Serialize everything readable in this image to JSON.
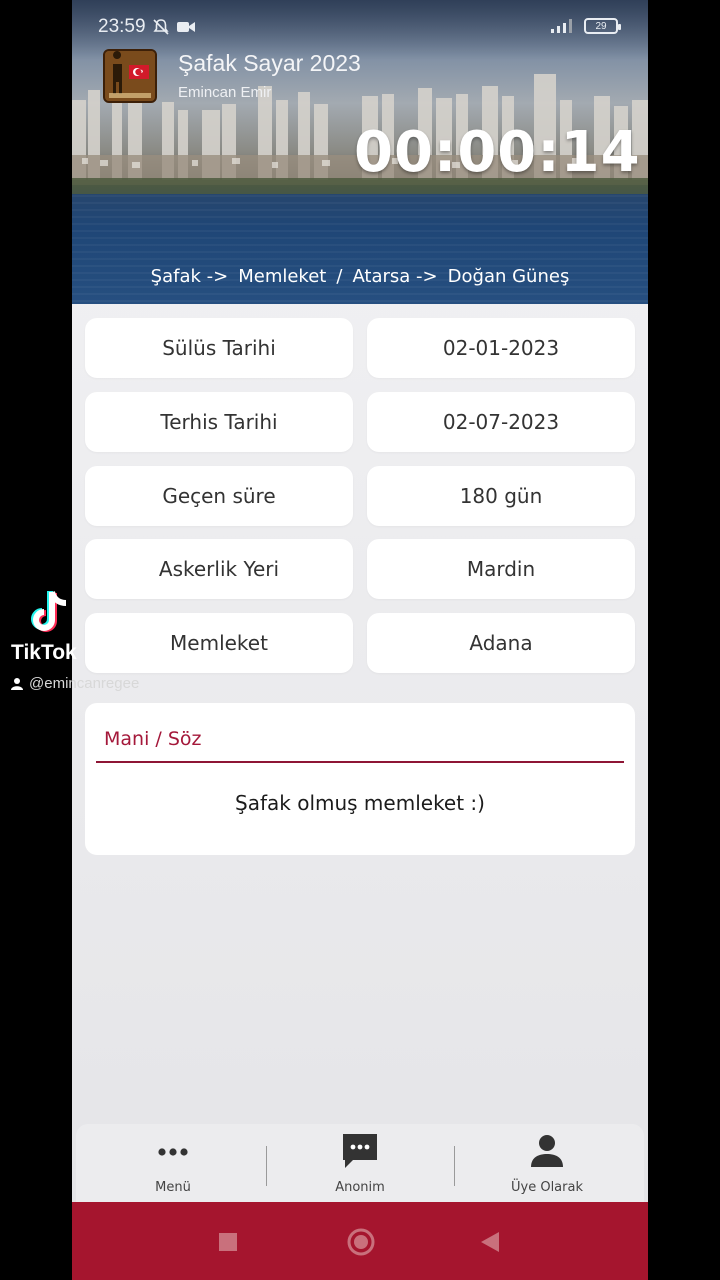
{
  "status_bar": {
    "time": "23:59",
    "battery": "29"
  },
  "app": {
    "title": "Şafak Sayar 2023",
    "subtitle": "Emincan Emir",
    "timer": "00:00:14",
    "route": [
      "Şafak ->",
      "Memleket",
      "/",
      "Atarsa ->",
      "Doğan Güneş"
    ]
  },
  "info": {
    "rows": [
      {
        "label": "Sülüs Tarihi",
        "value": "02-01-2023"
      },
      {
        "label": "Terhis Tarihi",
        "value": "02-07-2023"
      },
      {
        "label": "Geçen süre",
        "value": "180 gün"
      },
      {
        "label": "Askerlik Yeri",
        "value": "Mardin"
      },
      {
        "label": "Memleket",
        "value": "Adana"
      }
    ]
  },
  "mani": {
    "label": "Mani / Söz",
    "text": "Şafak olmuş memleket :)"
  },
  "bottom_nav": {
    "items": [
      {
        "label": "Menü",
        "icon": "more-dots-icon"
      },
      {
        "label": "Anonim",
        "icon": "chat-bubble-icon"
      },
      {
        "label": "Üye Olarak",
        "icon": "person-icon"
      }
    ]
  },
  "tiktok": {
    "brand": "TikTok",
    "username": "@emincanregee"
  },
  "colors": {
    "accent": "#a4183a",
    "android_bar": "#a5152e",
    "card_bg": "#ffffff"
  }
}
